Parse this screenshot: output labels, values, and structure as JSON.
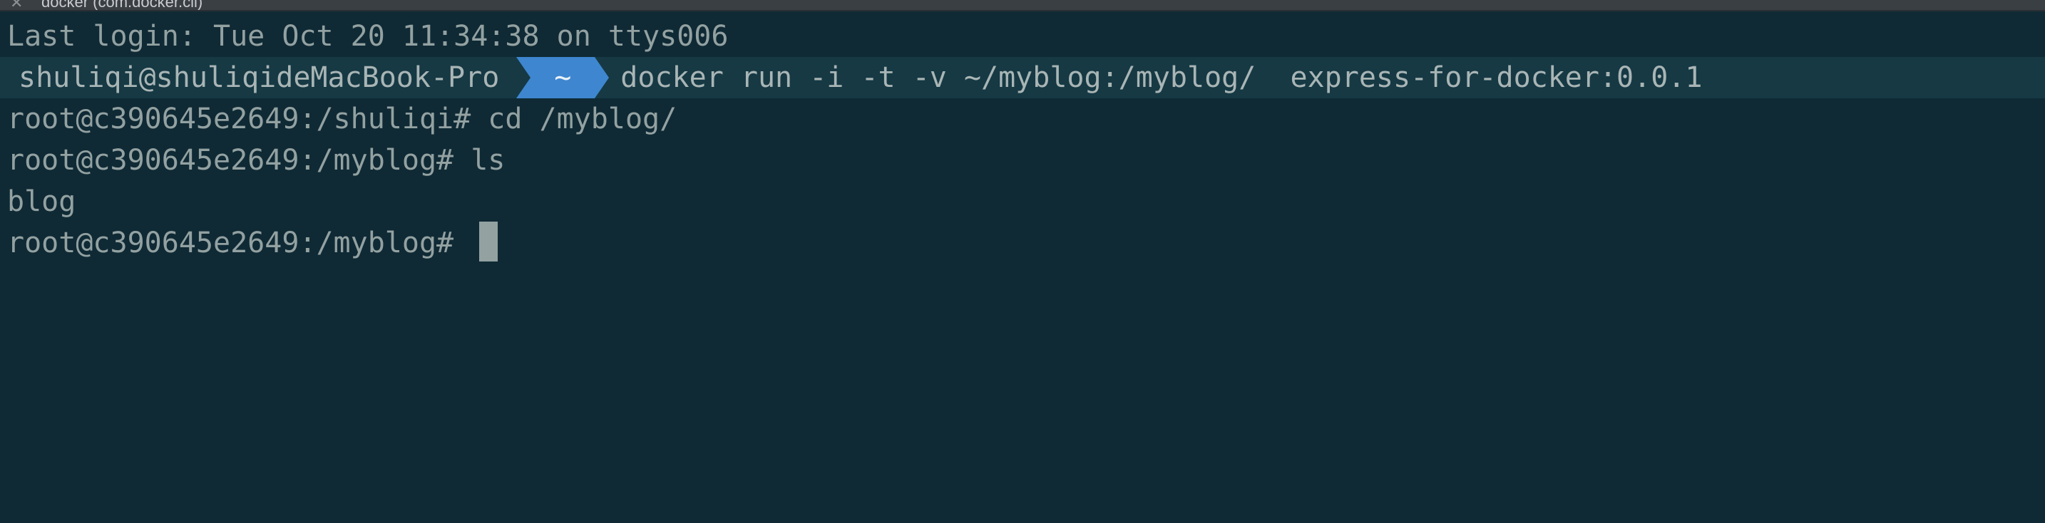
{
  "window": {
    "title": "docker (com.docker.cli)"
  },
  "terminal": {
    "last_login": "Last login: Tue Oct 20 11:34:38 on ttys006",
    "prompt": {
      "user_host": "shuliqi@shuliqideMacBook-Pro",
      "cwd": "~",
      "command": "docker run -i -t -v ~/myblog:/myblog/  express-for-docker:0.0.1"
    },
    "lines": [
      "root@c390645e2649:/shuliqi# cd /myblog/",
      "root@c390645e2649:/myblog# ls",
      "blog"
    ],
    "current_prompt": "root@c390645e2649:/myblog# "
  },
  "colors": {
    "background": "#0f2a35",
    "text": "#93a1a1",
    "prompt_segment": "#3e86cf",
    "cursor": "#93a1a1"
  }
}
